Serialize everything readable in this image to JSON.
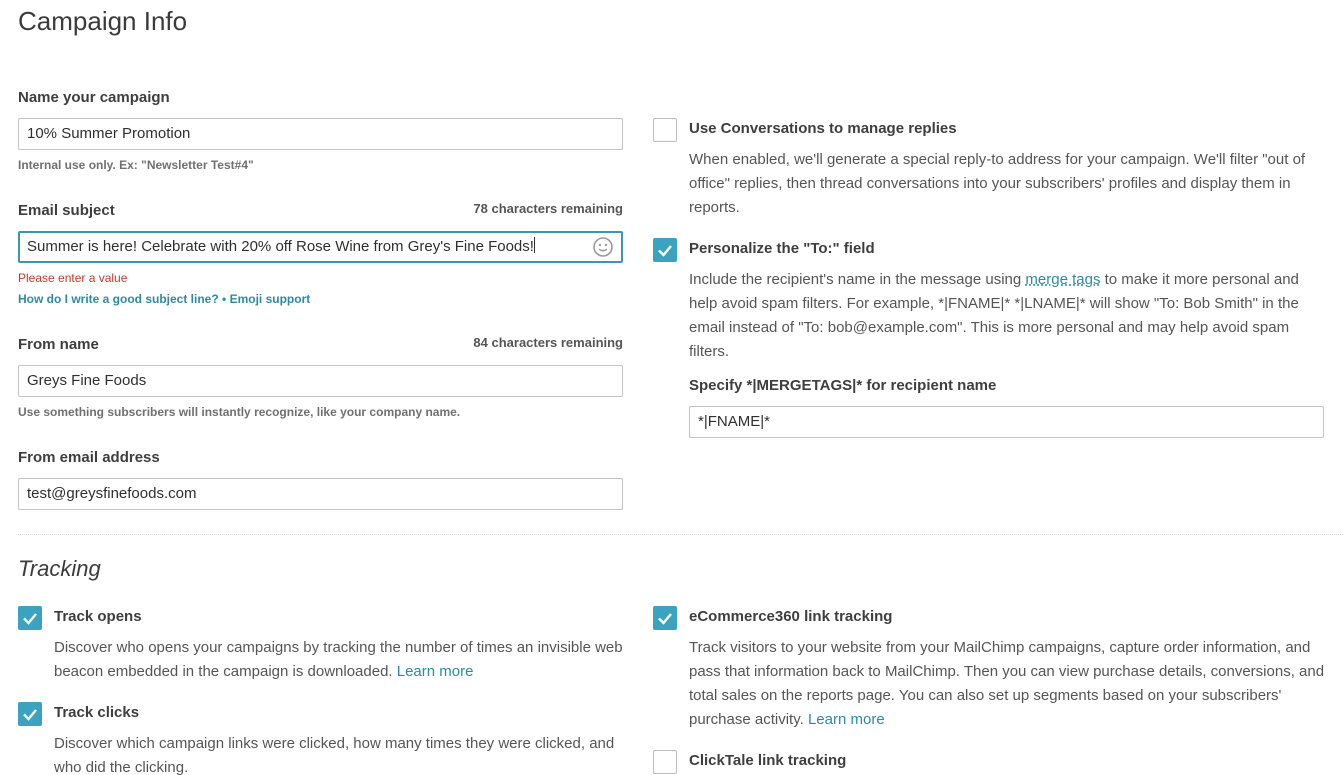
{
  "page_title": "Campaign Info",
  "campaign_name": {
    "label": "Name your campaign",
    "value": "10% Summer Promotion",
    "hint": "Internal use only. Ex: \"Newsletter Test#4\""
  },
  "email_subject": {
    "label": "Email subject",
    "counter": "78 characters remaining",
    "value": "Summer is here! Celebrate with 20% off Rose Wine from Grey's Fine Foods!",
    "error": "Please enter a value",
    "help_link": "How do I write a good subject line?",
    "separator": " • ",
    "emoji_link": "Emoji support"
  },
  "from_name": {
    "label": "From name",
    "counter": "84 characters remaining",
    "value": "Greys Fine Foods",
    "hint": "Use something subscribers will instantly recognize, like your company name."
  },
  "from_email": {
    "label": "From email address",
    "value": "test@greysfinefoods.com"
  },
  "conversations": {
    "checked": false,
    "label": "Use Conversations to manage replies",
    "description": "When enabled, we'll generate a special reply-to address for your campaign. We'll filter \"out of office\" replies, then thread conversations into your subscribers' profiles and display them in reports."
  },
  "personalize": {
    "checked": true,
    "label": "Personalize the \"To:\" field",
    "desc_before": "Include the recipient's name in the message using ",
    "desc_link": "merge tags",
    "desc_after": " to make it more personal and help avoid spam filters. For example, *|FNAME|* *|LNAME|* will show \"To: Bob Smith\" in the email instead of \"To: bob@example.com\". This is more personal and may help avoid spam filters.",
    "mergetag_label": "Specify *|MERGETAGS|* for recipient name",
    "mergetag_value": "*|FNAME|*"
  },
  "tracking": {
    "section_title": "Tracking",
    "track_opens": {
      "checked": true,
      "label": "Track opens",
      "description": "Discover who opens your campaigns by tracking the number of times an invisible web beacon embedded in the campaign is downloaded.",
      "learn_more": "Learn more"
    },
    "track_clicks": {
      "checked": true,
      "label": "Track clicks",
      "description": "Discover which campaign links were clicked, how many times they were clicked, and who did the clicking."
    },
    "ecommerce": {
      "checked": true,
      "label": "eCommerce360 link tracking",
      "description": "Track visitors to your website from your MailChimp campaigns, capture order information, and pass that information back to MailChimp. Then you can view purchase details, conversions, and total sales on the reports page. You can also set up segments based on your subscribers' purchase activity.",
      "learn_more": "Learn more"
    },
    "clicktale": {
      "checked": false,
      "label": "ClickTale link tracking"
    }
  },
  "colors": {
    "accent": "#3ba3bf",
    "link": "#2f8aa0",
    "error": "#c3392b"
  },
  "icons": {
    "emoji": "smiley-icon",
    "check": "checkmark-icon"
  }
}
